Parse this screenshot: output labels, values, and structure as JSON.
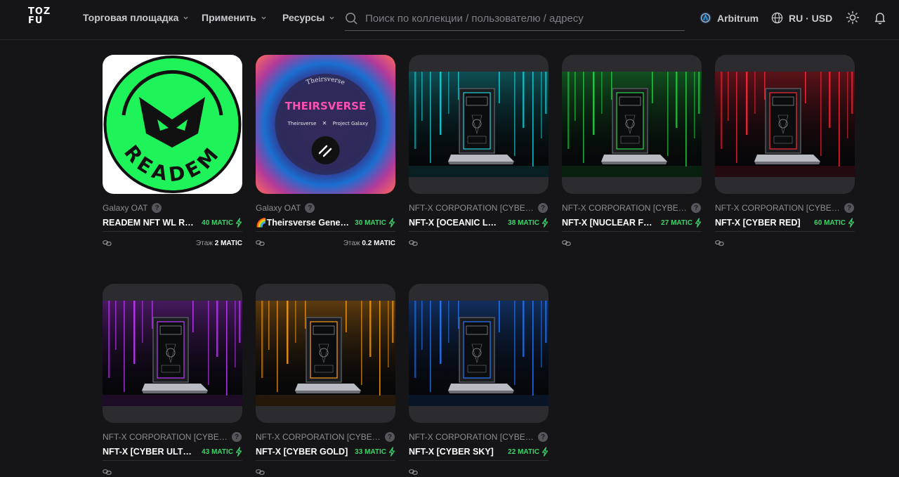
{
  "header": {
    "logo_line1": "TOZ",
    "logo_line2": "FU",
    "nav": [
      {
        "label": "Торговая площадка"
      },
      {
        "label": "Применить"
      },
      {
        "label": "Ресурсы"
      }
    ],
    "search_placeholder": "Поиск по коллекции / пользователю / адресу",
    "network_label": "Arbitrum",
    "locale_label": "RU · USD"
  },
  "cards": [
    {
      "collection": "Galaxy OAT",
      "name": "READEM NFT WL Rea...",
      "price": "40 MATIC",
      "floor_label": "Этаж",
      "floor_value": "2 MATIC"
    },
    {
      "collection": "Galaxy OAT",
      "name": "🌈Theirsverse Genes...",
      "price": "30 MATIC",
      "floor_label": "Этаж",
      "floor_value": "0.2 MATIC"
    },
    {
      "collection": "NFT-X CORPORATION [CYBER D...",
      "name": "NFT-X [OCEANIC LAG...",
      "price": "38 MATIC"
    },
    {
      "collection": "NFT-X CORPORATION [CYBER D...",
      "name": "NFT-X [NUCLEAR FOG]",
      "price": "27 MATIC"
    },
    {
      "collection": "NFT-X CORPORATION [CYBER D...",
      "name": "NFT-X [CYBER RED]",
      "price": "60 MATIC"
    },
    {
      "collection": "NFT-X CORPORATION [CYBER D...",
      "name": "NFT-X [CYBER ULTRA...",
      "price": "43 MATIC"
    },
    {
      "collection": "NFT-X CORPORATION [CYBER D...",
      "name": "NFT-X [CYBER GOLD]",
      "price": "33 MATIC"
    },
    {
      "collection": "NFT-X CORPORATION [CYBER D...",
      "name": "NFT-X [CYBER SKY]",
      "price": "22 MATIC"
    }
  ],
  "art_text": {
    "readem_word": "READEM",
    "theirsverse_title": "THEIRSVERSE",
    "theirsverse_sub1": "Theirsverse",
    "theirsverse_x": "✕",
    "theirsverse_sub2": "Project Galaxy",
    "ring_text": "Theirsverse"
  },
  "colors": {
    "accent_green": "#3fd26a",
    "readem_green": "#1ff35a",
    "cyber_palettes": [
      "#1fd6e0",
      "#2bd84a",
      "#ff2a3a",
      "#c23cff",
      "#ff9d1c",
      "#2a7bff"
    ]
  }
}
